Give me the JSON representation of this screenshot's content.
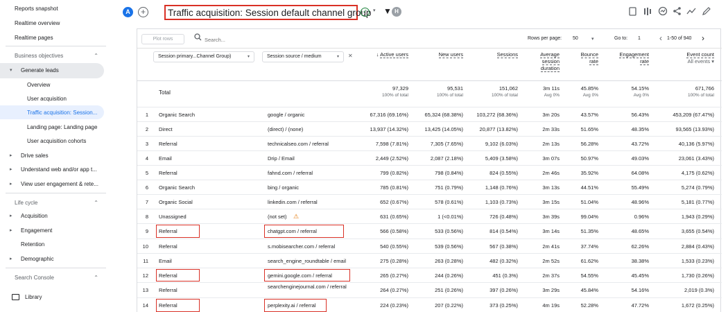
{
  "sidebar": {
    "items": [
      {
        "label": "Reports snapshot"
      },
      {
        "label": "Realtime overview"
      },
      {
        "label": "Realtime pages"
      },
      {
        "label": "Business objectives"
      },
      {
        "label": "Generate leads"
      },
      {
        "label": "Overview"
      },
      {
        "label": "User acquisition"
      },
      {
        "label": "Traffic acquisition: Session..."
      },
      {
        "label": "Landing page: Landing page"
      },
      {
        "label": "User acquisition cohorts"
      },
      {
        "label": "Drive sales"
      },
      {
        "label": "Understand web and/or app t..."
      },
      {
        "label": "View user engagement & rete..."
      },
      {
        "label": "Life cycle"
      },
      {
        "label": "Acquisition"
      },
      {
        "label": "Engagement"
      },
      {
        "label": "Retention"
      },
      {
        "label": "Demographic"
      },
      {
        "label": "Search Console"
      },
      {
        "label": "Library"
      }
    ]
  },
  "header": {
    "account_initial": "A",
    "add_symbol": "+",
    "title": "Traffic acquisition: Session default channel group",
    "user_initial": "H"
  },
  "toolbar": {
    "plot_rows_label": "Plot rows",
    "search_placeholder": "Search...",
    "rows_per_page_label": "Rows per page:",
    "rows_per_page_value": "50",
    "go_to_label": "Go to:",
    "go_to_value": "1",
    "pagination": "1-50 of 940"
  },
  "dimensions": {
    "primary": "Session primary...Channel Group)",
    "secondary": "Session source / medium"
  },
  "columns": [
    {
      "key": "active_users",
      "lines": [
        "Active users"
      ],
      "sub": "100% of total",
      "total": "97,329",
      "sorted": true
    },
    {
      "key": "new_users",
      "lines": [
        "New users"
      ],
      "sub": "100% of total",
      "total": "95,531"
    },
    {
      "key": "sessions",
      "lines": [
        "Sessions"
      ],
      "sub": "100% of total",
      "total": "151,062"
    },
    {
      "key": "avg_session",
      "lines": [
        "Average",
        "session",
        "duration"
      ],
      "sub": "Avg 0%",
      "total": "3m 11s"
    },
    {
      "key": "bounce",
      "lines": [
        "Bounce",
        "rate"
      ],
      "sub": "Avg 0%",
      "total": "45.85%"
    },
    {
      "key": "engagement",
      "lines": [
        "Engagement",
        "rate"
      ],
      "sub": "Avg 0%",
      "total": "54.15%"
    },
    {
      "key": "event_count",
      "lines": [
        "Event count",
        "All events"
      ],
      "sub": "100% of total",
      "total": "671,766"
    }
  ],
  "total_label": "Total",
  "rows": [
    {
      "rank": "1",
      "channel": "Organic Search",
      "source": "google / organic",
      "active": "67,316 (69.16%)",
      "new": "65,324 (68.38%)",
      "sessions": "103,272 (68.36%)",
      "avg": "3m 20s",
      "bounce": "43.57%",
      "engagement": "56.43%",
      "events": "453,209 (67.47%)"
    },
    {
      "rank": "2",
      "channel": "Direct",
      "source": "(direct) / (none)",
      "active": "13,937 (14.32%)",
      "new": "13,425 (14.05%)",
      "sessions": "20,877 (13.82%)",
      "avg": "2m 33s",
      "bounce": "51.65%",
      "engagement": "48.35%",
      "events": "93,565 (13.93%)"
    },
    {
      "rank": "3",
      "channel": "Referral",
      "source": "technicalseo.com / referral",
      "active": "7,598 (7.81%)",
      "new": "7,305 (7.65%)",
      "sessions": "9,102 (6.03%)",
      "avg": "2m 13s",
      "bounce": "56.28%",
      "engagement": "43.72%",
      "events": "40,136 (5.97%)"
    },
    {
      "rank": "4",
      "channel": "Email",
      "source": "Drip / Email",
      "active": "2,449 (2.52%)",
      "new": "2,087 (2.18%)",
      "sessions": "5,409 (3.58%)",
      "avg": "3m 07s",
      "bounce": "50.97%",
      "engagement": "49.03%",
      "events": "23,061 (3.43%)"
    },
    {
      "rank": "5",
      "channel": "Referral",
      "source": "fahnd.com / referral",
      "active": "799 (0.82%)",
      "new": "798 (0.84%)",
      "sessions": "824 (0.55%)",
      "avg": "2m 46s",
      "bounce": "35.92%",
      "engagement": "64.08%",
      "events": "4,175 (0.62%)"
    },
    {
      "rank": "6",
      "channel": "Organic Search",
      "source": "bing / organic",
      "active": "785 (0.81%)",
      "new": "751 (0.79%)",
      "sessions": "1,148 (0.76%)",
      "avg": "3m 13s",
      "bounce": "44.51%",
      "engagement": "55.49%",
      "events": "5,274 (0.79%)"
    },
    {
      "rank": "7",
      "channel": "Organic Social",
      "source": "linkedin.com / referral",
      "active": "652 (0.67%)",
      "new": "578 (0.61%)",
      "sessions": "1,103 (0.73%)",
      "avg": "3m 15s",
      "bounce": "51.04%",
      "engagement": "48.96%",
      "events": "5,181 (0.77%)"
    },
    {
      "rank": "8",
      "channel": "Unassigned",
      "source": "(not set)",
      "active": "631 (0.65%)",
      "new": "1 (<0.01%)",
      "sessions": "726 (0.48%)",
      "avg": "3m 39s",
      "bounce": "99.04%",
      "engagement": "0.96%",
      "events": "1,943 (0.29%)"
    },
    {
      "rank": "9",
      "channel": "Referral",
      "source": "chatgpt.com / referral",
      "active": "566 (0.58%)",
      "new": "533 (0.56%)",
      "sessions": "814 (0.54%)",
      "avg": "3m 14s",
      "bounce": "51.35%",
      "engagement": "48.65%",
      "events": "3,655 (0.54%)"
    },
    {
      "rank": "10",
      "channel": "Referral",
      "source": "s.mobisearcher.com / referral",
      "active": "540 (0.55%)",
      "new": "539 (0.56%)",
      "sessions": "567 (0.38%)",
      "avg": "2m 41s",
      "bounce": "37.74%",
      "engagement": "62.26%",
      "events": "2,884 (0.43%)"
    },
    {
      "rank": "11",
      "channel": "Email",
      "source": "search_engine_roundtable / email",
      "active": "275 (0.28%)",
      "new": "263 (0.28%)",
      "sessions": "482 (0.32%)",
      "avg": "2m 52s",
      "bounce": "61.62%",
      "engagement": "38.38%",
      "events": "1,533 (0.23%)"
    },
    {
      "rank": "12",
      "channel": "Referral",
      "source": "gemini.google.com / referral",
      "active": "265 (0.27%)",
      "new": "244 (0.26%)",
      "sessions": "451 (0.3%)",
      "avg": "2m 37s",
      "bounce": "54.55%",
      "engagement": "45.45%",
      "events": "1,730 (0.26%)"
    },
    {
      "rank": "13",
      "channel": "Referral",
      "source": "searchenginejournal.com / referral",
      "active": "264 (0.27%)",
      "new": "251 (0.26%)",
      "sessions": "397 (0.26%)",
      "avg": "3m 29s",
      "bounce": "45.84%",
      "engagement": "54.16%",
      "events": "2,019 (0.3%)"
    },
    {
      "rank": "14",
      "channel": "Referral",
      "source": "perplexity.ai / referral",
      "active": "224 (0.23%)",
      "new": "207 (0.22%)",
      "sessions": "373 (0.25%)",
      "avg": "4m 19s",
      "bounce": "52.28%",
      "engagement": "47.72%",
      "events": "1,672 (0.25%)"
    }
  ],
  "colors": {
    "accent": "#1a73e8",
    "highlight": "#d93025",
    "warning": "#e37400"
  },
  "icons": [
    "plus-icon",
    "check-circle-icon",
    "filter-icon",
    "search-icon",
    "save-icon",
    "compare-icon",
    "insights-icon",
    "share-icon",
    "trend-icon",
    "edit-icon",
    "warning-icon",
    "folder-icon"
  ]
}
